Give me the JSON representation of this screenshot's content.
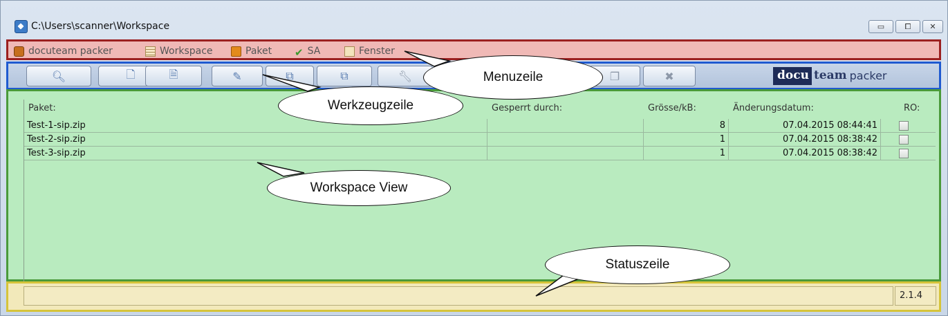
{
  "window": {
    "title": "C:\\Users\\scanner\\Workspace",
    "buttons": {
      "minimize": "▭",
      "maximize": "⧠",
      "close": "✕"
    }
  },
  "menu": {
    "items": [
      {
        "label": "docuteam packer",
        "icon": "packer-icon"
      },
      {
        "label": "Workspace",
        "icon": "workspace-icon"
      },
      {
        "label": "Paket",
        "icon": "package-icon"
      },
      {
        "label": "SA",
        "icon": "checkmark-icon"
      },
      {
        "label": "Fenster",
        "icon": "window-icon"
      }
    ]
  },
  "toolbar": {
    "icons": [
      "search-icon",
      "new-document-icon",
      "document-icon",
      "edit-package-icon",
      "open-package-icon",
      "package-icon",
      "wrench-icon",
      "copy-icon",
      "delete-icon"
    ],
    "brand": {
      "part1": "docu",
      "part2": "team",
      "part3": "packer"
    }
  },
  "table": {
    "columns": [
      "Paket:",
      "Gesperrt durch:",
      "Grösse/kB:",
      "Änderungsdatum:",
      "RO:"
    ],
    "rows": [
      {
        "name": "Test-1-sip.zip",
        "locked_by": "",
        "size": "8",
        "date": "07.04.2015 08:44:41",
        "ro": false
      },
      {
        "name": "Test-2-sip.zip",
        "locked_by": "",
        "size": "1",
        "date": "07.04.2015 08:38:42",
        "ro": false
      },
      {
        "name": "Test-3-sip.zip",
        "locked_by": "",
        "size": "1",
        "date": "07.04.2015 08:38:42",
        "ro": false
      }
    ]
  },
  "status": {
    "text": "",
    "version": "2.1.4"
  },
  "callouts": {
    "menu": "Menuzeile",
    "toolbar": "Werkzeugzeile",
    "workspace": "Workspace View",
    "status": "Statuszeile"
  },
  "colors": {
    "menu_border": "#9b2020",
    "toolbar_border": "#1f5ad0",
    "workspace_border": "#4a9a3a",
    "status_border": "#d6c43a"
  }
}
